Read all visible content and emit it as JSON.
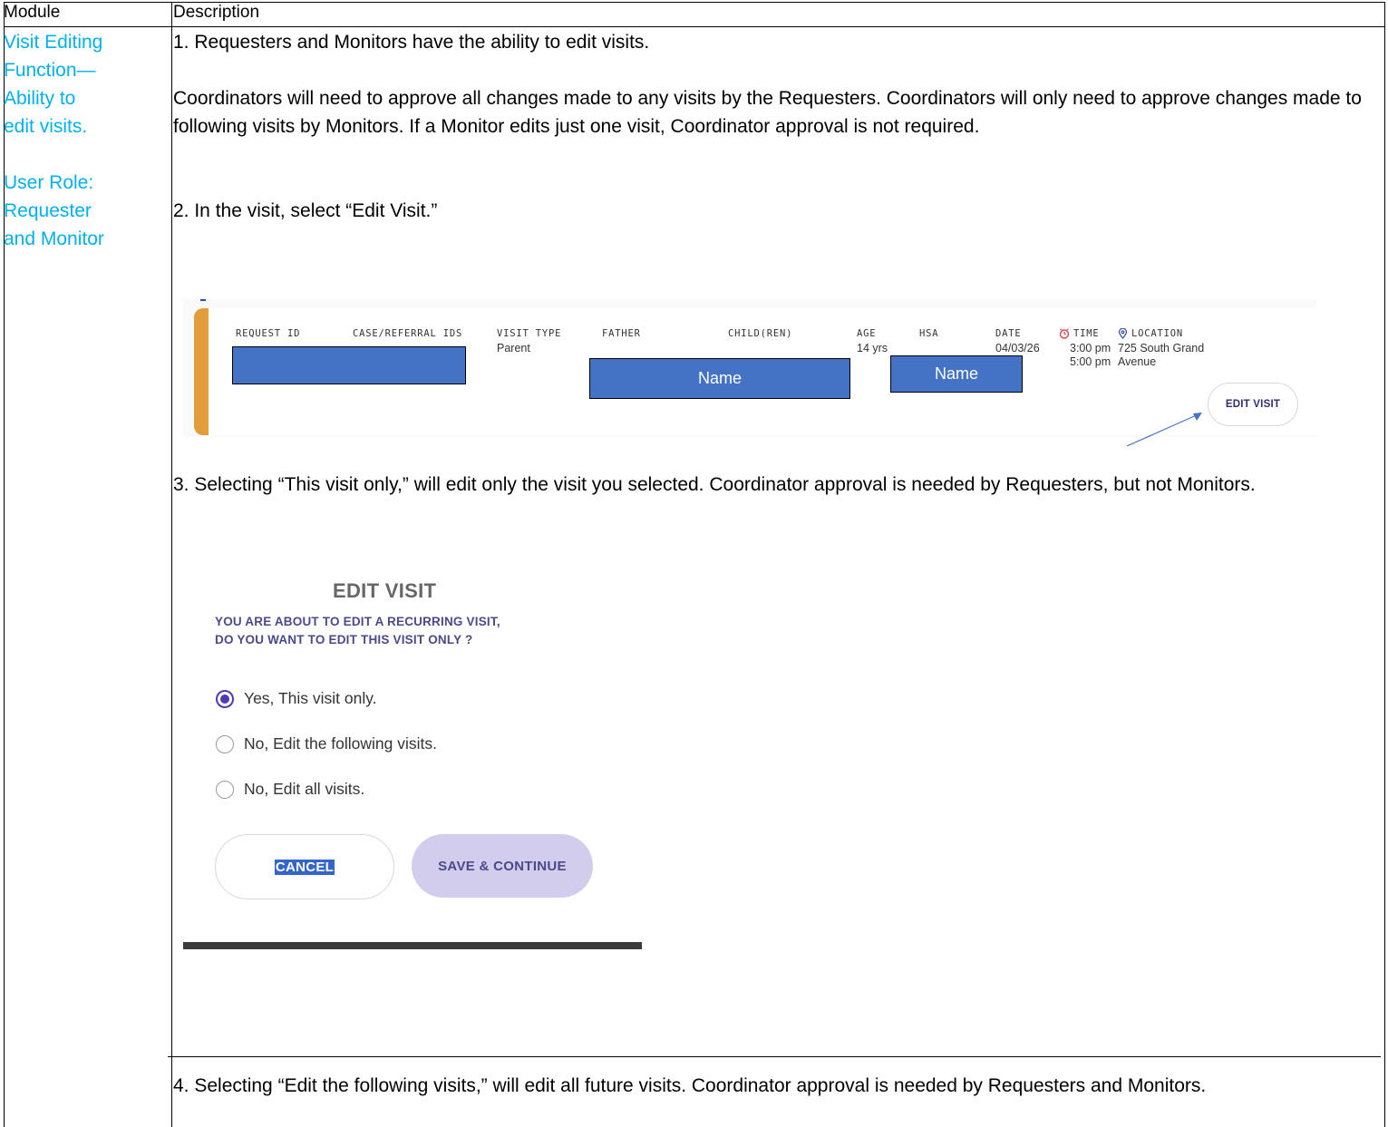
{
  "table": {
    "header_module": "Module",
    "header_description": "Description"
  },
  "module_column": {
    "lines": [
      "Visit Editing",
      "Function—",
      "Ability to",
      "edit visits."
    ],
    "role_lines": [
      "User Role:",
      "Requester",
      "and Monitor"
    ],
    "text_color": "#00b0f0"
  },
  "description": {
    "p1": "1.  Requesters and Monitors have the ability to edit visits.",
    "p2": "Coordinators will need to approve all changes made to any visits by the Requesters.  Coordinators will only need to approve changes made to following visits by Monitors.  If a Monitor edits just one visit, Coordinator approval is not required.",
    "p3": "2.  In the visit, select “Edit Visit.”",
    "p4": "3.  Selecting “This visit only,” will edit only the visit you selected.  Coordinator approval is needed by Requesters, but not Monitors.",
    "p5": "4.  Selecting “Edit the following visits,” will edit all future visits.  Coordinator approval is needed by Requesters and Monitors."
  },
  "visit_screenshot": {
    "columns": {
      "request_id": "REQUEST ID",
      "case_ids": "CASE/REFERRAL IDS",
      "visit_type": "VISIT TYPE",
      "father": "FATHER",
      "children": "CHILD(REN)",
      "age": "AGE",
      "hsa": "HSA",
      "date": "DATE",
      "time": "TIME",
      "location": "LOCATION"
    },
    "values": {
      "visit_type": "Parent",
      "age": "14 yrs",
      "date": "04/03/26",
      "time_start": "3:00 pm",
      "time_end": "5:00 pm",
      "location_line1": "725 South Grand",
      "location_line2": "Avenue"
    },
    "redaction_label_1": "Name",
    "redaction_label_2": "Name",
    "edit_visit_button": "EDIT VISIT",
    "stripe_color": "#e19d3a",
    "redaction_color": "#4472c4"
  },
  "dialog_screenshot": {
    "title": "EDIT VISIT",
    "question_line1": "YOU ARE ABOUT TO EDIT A RECURRING VISIT,",
    "question_line2": "DO YOU WANT TO EDIT THIS VISIT ONLY ?",
    "options": [
      {
        "label": "Yes, This visit only.",
        "checked": true
      },
      {
        "label": "No, Edit the following visits.",
        "checked": false
      },
      {
        "label": "No, Edit all visits.",
        "checked": false
      }
    ],
    "cancel_button": "CANCEL",
    "save_button": "SAVE & CONTINUE",
    "accent_color": "#4b3bb5"
  }
}
